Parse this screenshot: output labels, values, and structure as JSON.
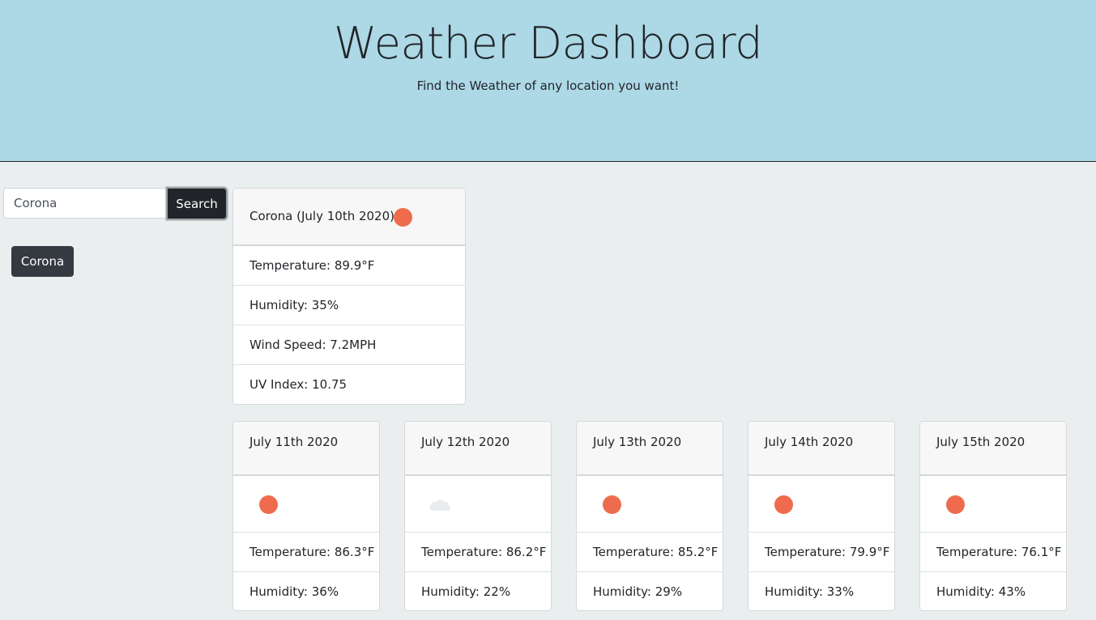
{
  "header": {
    "title": "Weather Dashboard",
    "subtitle": "Find the Weather of any location you want!",
    "background": "#add8e6"
  },
  "search": {
    "value": "Corona",
    "button_label": "Search"
  },
  "history": [
    {
      "label": "Corona"
    }
  ],
  "current": {
    "title": "Corona (July 10th 2020)",
    "icon": "sun-icon",
    "temperature": "Temperature: 89.9°F",
    "humidity": "Humidity: 35%",
    "wind": "Wind Speed: 7.2MPH",
    "uv": "UV Index: 10.75"
  },
  "forecast": [
    {
      "date": "July 11th 2020",
      "icon": "sun-icon",
      "temperature": "Temperature: 86.3°F",
      "humidity": "Humidity: 36%"
    },
    {
      "date": "July 12th 2020",
      "icon": "cloud-icon",
      "temperature": "Temperature: 86.2°F",
      "humidity": "Humidity: 22%"
    },
    {
      "date": "July 13th 2020",
      "icon": "sun-icon",
      "temperature": "Temperature: 85.2°F",
      "humidity": "Humidity: 29%"
    },
    {
      "date": "July 14th 2020",
      "icon": "sun-icon",
      "temperature": "Temperature: 79.9°F",
      "humidity": "Humidity: 33%"
    },
    {
      "date": "July 15th 2020",
      "icon": "sun-icon",
      "temperature": "Temperature: 76.1°F",
      "humidity": "Humidity: 43%"
    }
  ],
  "colors": {
    "sun": "#ee6c4d",
    "dark_button": "#212529",
    "history_button": "#343a40",
    "page_background": "#ebeeef"
  }
}
